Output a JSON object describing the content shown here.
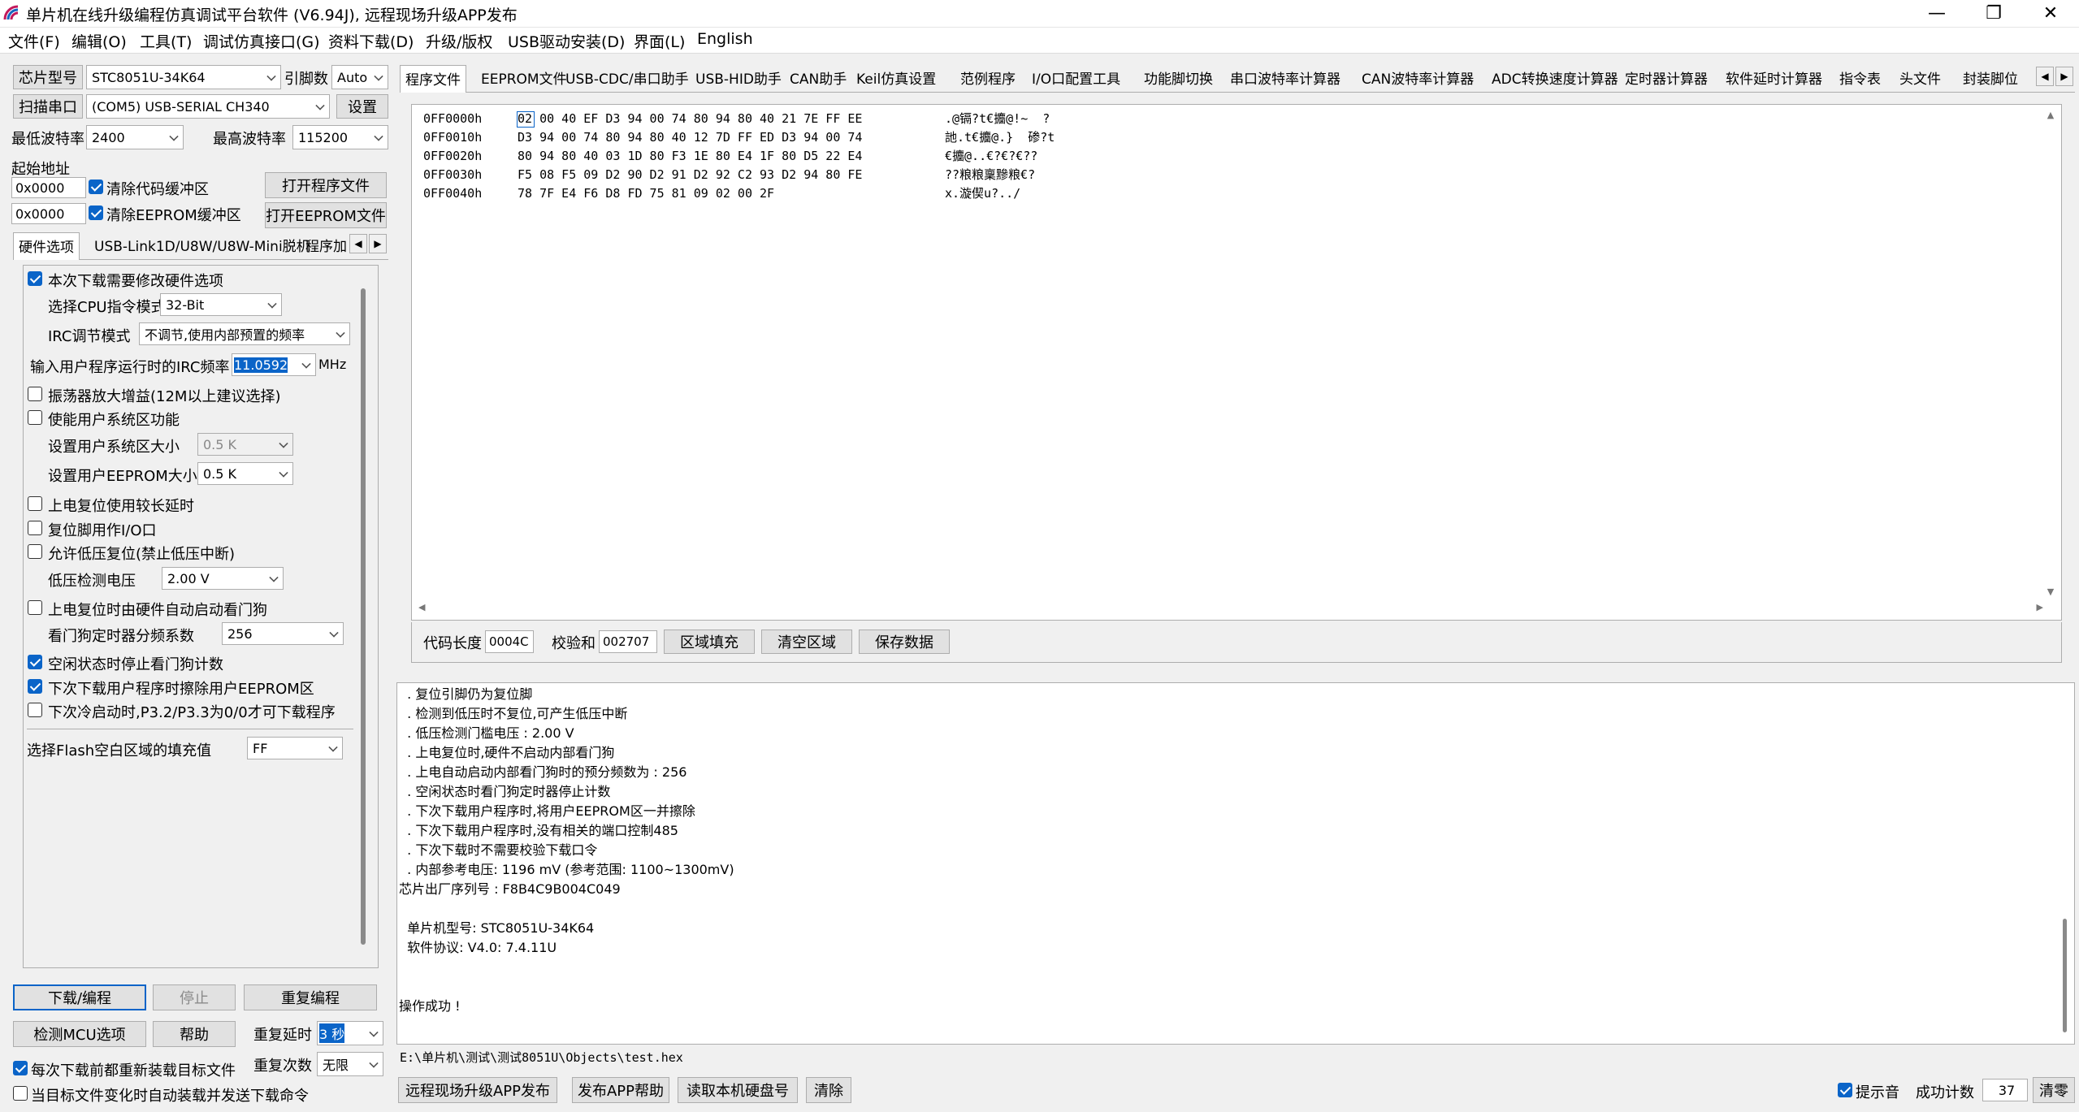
{
  "window": {
    "title": "单片机在线升级编程仿真调试平台软件 (V6.94J), 远程现场升级APP发布",
    "min": "—",
    "max": "❐",
    "close": "✕"
  },
  "menu": [
    "文件(F)",
    "编辑(O)",
    "工具(T)",
    "调试仿真接口(G)",
    "资料下载(D)",
    "升级/版权",
    "USB驱动安装(D)",
    "界面(L)",
    "English"
  ],
  "left": {
    "chip_label": "芯片型号",
    "chip_value": "STC8051U-34K64",
    "pins_label": "引脚数",
    "pins_value": "Auto",
    "scan_button": "扫描串口",
    "port_value": "(COM5) USB-SERIAL CH340",
    "settings_button": "设置",
    "min_baud_label": "最低波特率",
    "min_baud_value": "2400",
    "max_baud_label": "最高波特率",
    "max_baud_value": "115200",
    "start_addr_label": "起始地址",
    "addr1": "0x0000",
    "addr2": "0x0000",
    "clear_code_label": "清除代码缓冲区",
    "clear_eeprom_label": "清除EEPROM缓冲区",
    "open_program_button": "打开程序文件",
    "open_eeprom_button": "打开EEPROM文件",
    "tabs": [
      "硬件选项",
      "USB-Link1D/U8W/U8W-Mini脱机",
      "程序加"
    ],
    "hw": {
      "modify_label": "本次下载需要修改硬件选项",
      "cpu_mode_label": "选择CPU指令模式",
      "cpu_mode_value": "32-Bit",
      "irc_mode_label": "IRC调节模式",
      "irc_mode_value": "不调节,使用内部预置的频率",
      "irc_freq_label": "输入用户程序运行时的IRC频率",
      "irc_freq_value": "11.0592",
      "irc_unit": "MHz",
      "osc_gain_label": "振荡器放大增益(12M以上建议选择)",
      "user_sys_label": "使能用户系统区功能",
      "sys_size_label": "设置用户系统区大小",
      "sys_size_value": "0.5 K",
      "eeprom_size_label": "设置用户EEPROM大小",
      "eeprom_size_value": "0.5 K",
      "long_delay_label": "上电复位使用较长延时",
      "reset_io_label": "复位脚用作I/O口",
      "lvr_label": "允许低压复位(禁止低压中断)",
      "lv_label": "低压检测电压",
      "lv_value": "2.00 V",
      "wdt_label": "上电复位时由硬件自动启动看门狗",
      "wdt_div_label": "看门狗定时器分频系数",
      "wdt_div_value": "256",
      "idle_wdt_label": "空闲状态时停止看门狗计数",
      "erase_eeprom_label": "下次下载用户程序时擦除用户EEPROM区",
      "p32_label": "下次冷启动时,P3.2/P3.3为0/0才可下载程序",
      "fill_label": "选择Flash空白区域的填充值",
      "fill_value": "FF"
    },
    "download_button": "下载/编程",
    "stop_button": "停止",
    "reprogram_button": "重复编程",
    "detect_button": "检测MCU选项",
    "help_button": "帮助",
    "repeat_delay_label": "重复延时",
    "repeat_delay_value": "3 秒",
    "repeat_count_label": "重复次数",
    "repeat_count_value": "无限",
    "reload_label": "每次下载前都重新装载目标文件",
    "auto_label": "当目标文件变化时自动装载并发送下载命令"
  },
  "right": {
    "tabs": [
      "程序文件",
      "EEPROM文件",
      "USB-CDC/串口助手",
      "USB-HID助手",
      "CAN助手",
      "Keil仿真设置",
      "范例程序",
      "I/O口配置工具",
      "功能脚切换",
      "串口波特率计算器",
      "CAN波特率计算器",
      "ADC转换速度计算器",
      "定时器计算器",
      "软件延时计算器",
      "指令表",
      "头文件",
      "封装脚位"
    ],
    "hex_rows": [
      {
        "addr": "0FF0000h",
        "hex": "02 00 40 EF D3 94 00 74 80 94 80 40 21 7E FF EE",
        "ascii": ".@镉?t€攟@!~  ?"
      },
      {
        "addr": "0FF0010h",
        "hex": "D3 94 00 74 80 94 80 40 12 7D FF ED D3 94 00 74",
        "ascii": "訑.t€攟@.}  碜?t"
      },
      {
        "addr": "0FF0020h",
        "hex": "80 94 80 40 03 1D 80 F3 1E 80 E4 1F 80 D5 22 E4",
        "ascii": "€攟@..€?€?€??"
      },
      {
        "addr": "0FF0030h",
        "hex": "F5 08 F5 09 D2 90 D2 91 D2 92 C2 93 D2 94 80 FE",
        "ascii": "??粮粮稟黲粮€?"
      },
      {
        "addr": "0FF0040h",
        "hex": "78 7F E4 F6 D8 FD 75 81 09 02 00 2F",
        "ascii": "x.漩偰u?../"
      }
    ],
    "code_len_label": "代码长度",
    "code_len_value": "0004C",
    "checksum_label": "校验和",
    "checksum_value": "002707",
    "fill_button": "区域填充",
    "clear_button": "清空区域",
    "save_button": "保存数据",
    "log": [
      "  . 复位引脚仍为复位脚",
      "  . 检测到低压时不复位,可产生低压中断",
      "  . 低压检测门槛电压 : 2.00 V",
      "  . 上电复位时,硬件不启动内部看门狗",
      "  . 上电自动启动内部看门狗时的预分频数为 : 256",
      "  . 空闲状态时看门狗定时器停止计数",
      "  . 下次下载用户程序时,将用户EEPROM区一并擦除",
      "  . 下次下载用户程序时,没有相关的端口控制485",
      "  . 下次下载时不需要校验下载口令",
      "  . 内部参考电压: 1196 mV (参考范围: 1100~1300mV)",
      "芯片出厂序列号 : F8B4C9B004C049",
      "",
      "  单片机型号: STC8051U-34K64",
      "  软件协议: V4.0: 7.4.11U",
      "",
      "",
      "操作成功 !"
    ],
    "path": "E:\\单片机\\测试\\测试8051U\\Objects\\test.hex",
    "remote_button": "远程现场升级APP发布",
    "publish_help_button": "发布APP帮助",
    "read_disk_button": "读取本机硬盘号",
    "clear_log_button": "清除",
    "sound_label": "提示音",
    "success_label": "成功计数",
    "success_value": "37",
    "reset_count_button": "清零"
  }
}
